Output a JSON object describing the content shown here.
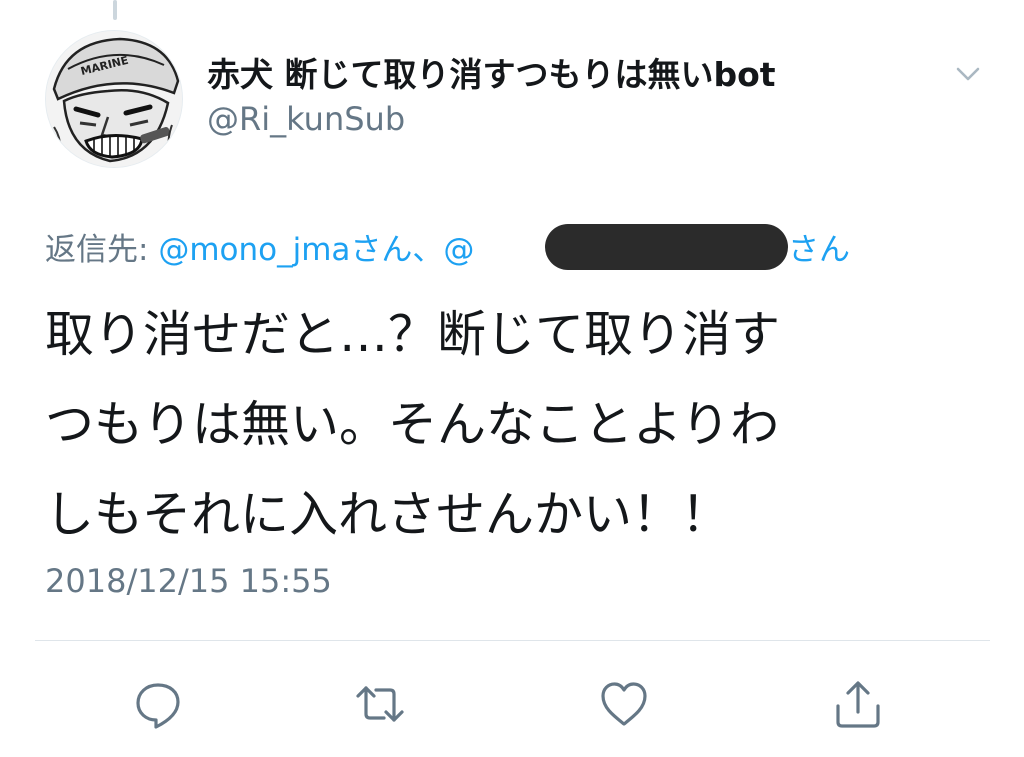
{
  "tweet": {
    "display_name": "赤犬 断じて取り消すつもりは無いbot",
    "handle": "@Ri_kunSub",
    "avatar_badge": "MARINE",
    "reply_label": "返信先:",
    "reply_to_visible": "@mono_jmaさん、@",
    "reply_suffix": "さん",
    "text_lines": [
      "取り消せだと…？断じて取り消す",
      "つもりは無い。そんなことよりわ",
      "しもそれに入れさせんかい！！"
    ],
    "timestamp": "2018/12/15 15:55"
  },
  "icons": {
    "caret": "chevron-down-icon",
    "reply": "reply-icon",
    "retweet": "retweet-icon",
    "like": "heart-icon",
    "share": "share-icon"
  },
  "colors": {
    "link": "#1da1f2",
    "secondary": "#657786",
    "text": "#14171a",
    "icon": "#657786"
  }
}
